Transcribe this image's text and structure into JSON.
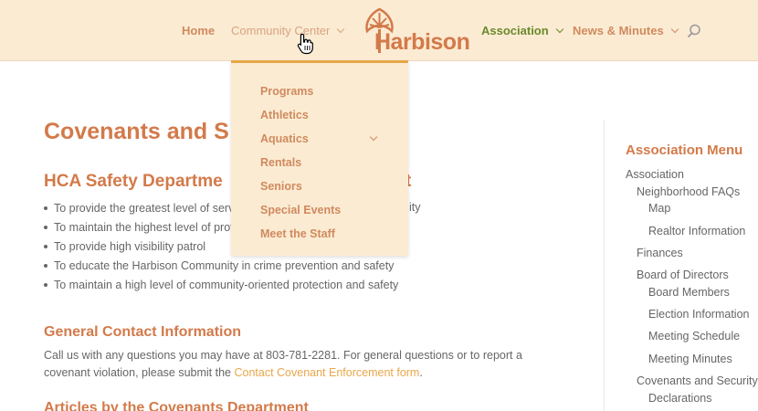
{
  "nav": {
    "home": "Home",
    "community_center": "Community Center",
    "association": "Association",
    "news": "News & Minutes",
    "logo_text": "Harbison"
  },
  "dropdown": {
    "items": [
      "Programs",
      "Athletics",
      "Aquatics",
      "Rentals",
      "Seniors",
      "Special Events",
      "Meet the Staff"
    ]
  },
  "content": {
    "title": "Covenants and S",
    "dept_heading_left": "HCA Safety Departme",
    "dept_heading_right": "t",
    "bullets": [
      "To provide the greatest level of servi",
      "To maintain the highest level of profe",
      "To provide high visibility patrol",
      "To educate the Harbison Community in crime prevention and safety",
      "To maintain a high level of community-oriented protection and safety"
    ],
    "bullet1_tail": "ity",
    "contact_heading": "General Contact Information",
    "contact_text_1": "Call us with any questions you may have at 803-781-2281. For general questions or to report a covenant violation, please submit the ",
    "contact_link": "Contact Covenant Enforcement form",
    "contact_text_2": ".",
    "articles_heading": "Articles by the Covenants Department"
  },
  "sidebar": {
    "title": "Association Menu",
    "items": [
      "Association",
      "Neighborhood FAQs",
      "Map",
      "Realtor Information",
      "Finances",
      "Board of Directors",
      "Board Members",
      "Election Information",
      "Meeting Schedule",
      "Meeting Minutes",
      "Covenants and Security",
      "Declarations"
    ]
  },
  "colors": {
    "header_bg": "#fbebd3",
    "accent_orange": "#d37a4a",
    "accent_green": "#6a8a2a",
    "link_gold": "#e8a74a"
  }
}
